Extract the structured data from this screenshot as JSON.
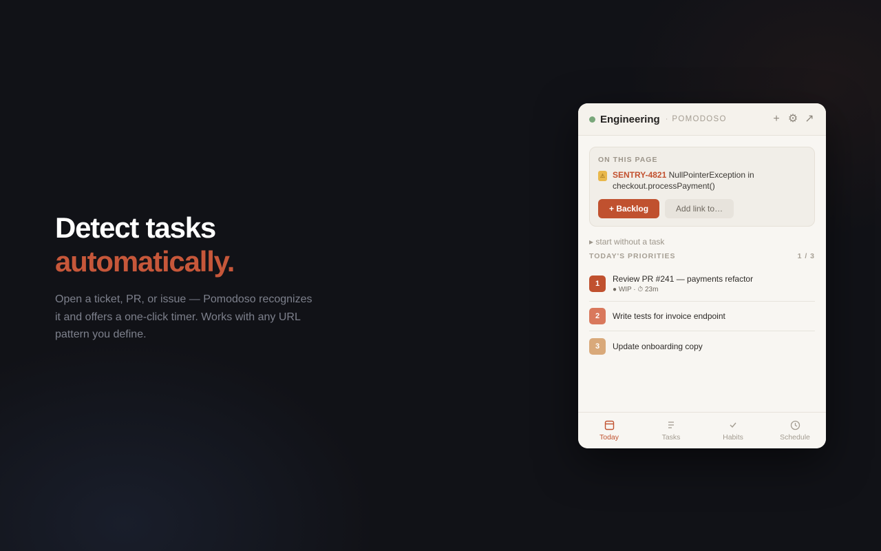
{
  "hero": {
    "title_line1": "Detect tasks",
    "title_line2": "automatically.",
    "description": "Open a ticket, PR, or issue — Pomodoso recognizes it and offers a one-click timer. Works with any URL pattern you define."
  },
  "panel": {
    "header": {
      "workspace": "Engineering",
      "separator": "·",
      "app_name": "POMODOSO",
      "actions": [
        {
          "name": "add-icon",
          "glyph": "+"
        },
        {
          "name": "gear-icon",
          "glyph": "⚙"
        },
        {
          "name": "external-link-icon",
          "glyph": "↗"
        }
      ]
    },
    "detected": {
      "label": "ON THIS PAGE",
      "badge_icon": "warning-icon",
      "badge_glyph": "⚠",
      "ticket_id": "SENTRY-4821",
      "ticket_text": "NullPointerException in checkout.processPayment()",
      "primary_button": "+ Backlog",
      "secondary_button": "Add link to…"
    },
    "start_without_task": "▸ start without a task",
    "priorities": {
      "title": "TODAY'S PRIORITIES",
      "count": "1 / 3",
      "items": [
        {
          "number": "1",
          "title": "Review PR #241 — payments refactor",
          "meta": "● WIP · ⏱ 23m",
          "color": "#c0512f"
        },
        {
          "number": "2",
          "title": "Write tests for invoice endpoint",
          "meta": "",
          "color": "#d9785c"
        },
        {
          "number": "3",
          "title": "Update onboarding copy",
          "meta": "",
          "color": "#d9a97a"
        }
      ]
    },
    "nav": [
      {
        "label": "Today",
        "icon": "calendar-icon",
        "active": true
      },
      {
        "label": "Tasks",
        "icon": "list-icon",
        "active": false
      },
      {
        "label": "Habits",
        "icon": "check-icon",
        "active": false
      },
      {
        "label": "Schedule",
        "icon": "clock-icon",
        "active": false
      }
    ]
  },
  "colors": {
    "accent": "#c0512f",
    "status_dot": "#79a77a",
    "warning": "#e9b84b"
  }
}
